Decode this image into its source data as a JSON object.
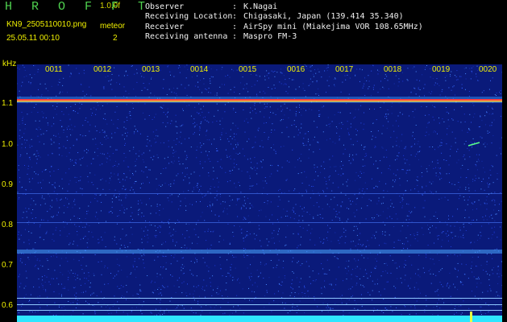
{
  "header": {
    "logo": "H R O F F T",
    "version": "1.0.0f",
    "file_name": "KN9_2505110010.png",
    "meteor_label": "meteor",
    "date_time": "25.05.11 00:10",
    "meteor_count": "2"
  },
  "meta": [
    {
      "label": "Observer",
      "value": "K.Nagai"
    },
    {
      "label": "Receiving Location",
      "value": "Chigasaki, Japan (139.414 35.340)"
    },
    {
      "label": "Receiver",
      "value": "AirSpy mini (Miakejima VOR 108.65MHz)"
    },
    {
      "label": "Receiving antenna",
      "value": "Maspro FM-3"
    }
  ],
  "plot": {
    "y_unit": "kHz",
    "y_ticks": [
      "1.1",
      "1.0",
      "0.9",
      "0.8",
      "0.7",
      "0.6"
    ],
    "time_ticks": [
      "0011",
      "0012",
      "0013",
      "0014",
      "0015",
      "0016",
      "0017",
      "0018",
      "0019",
      "0020"
    ]
  },
  "colors": {
    "background": "#0a1a7a",
    "noise_band": "#2ee6ff",
    "carrier_line": "#ff4040",
    "label_yellow": "#f0f000"
  }
}
